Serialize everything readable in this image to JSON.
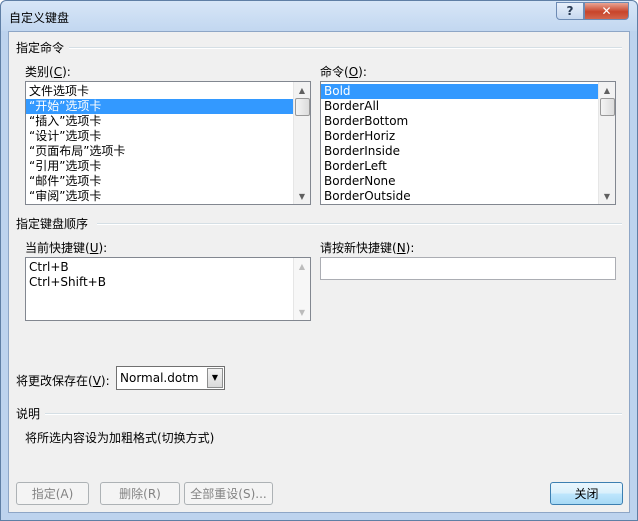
{
  "window": {
    "title": "自定义键盘"
  },
  "caption": {
    "help": "?",
    "close": "✕"
  },
  "specify_commands": {
    "group_label": "指定命令",
    "categories_label": "类别(",
    "categories_key": "C",
    "categories_suffix": "):",
    "categories": [
      "文件选项卡",
      "“开始”选项卡",
      "“插入”选项卡",
      "“设计”选项卡",
      "“页面布局”选项卡",
      "“引用”选项卡",
      "“邮件”选项卡",
      "“审阅”选项卡"
    ],
    "commands_label": "命令(",
    "commands_key": "O",
    "commands_suffix": "):",
    "commands": [
      "Bold",
      "BorderAll",
      "BorderBottom",
      "BorderHoriz",
      "BorderInside",
      "BorderLeft",
      "BorderNone",
      "BorderOutside"
    ]
  },
  "keyboard_sequence": {
    "group_label": "指定键盘顺序",
    "current_keys_label": "当前快捷键(",
    "current_keys_key": "U",
    "current_keys_suffix": "):",
    "current_keys": [
      "Ctrl+B",
      "Ctrl+Shift+B"
    ],
    "new_key_label": "请按新快捷键(",
    "new_key_key": "N",
    "new_key_suffix": "):",
    "new_key_value": ""
  },
  "save_in": {
    "label": "将更改保存在(",
    "key": "V",
    "suffix": "):",
    "value": "Normal.dotm"
  },
  "description": {
    "group_label": "说明",
    "text": "将所选内容设为加粗格式(切换方式)"
  },
  "buttons": {
    "assign": "指定(A)",
    "remove": "删除(R)",
    "reset_all": "全部重设(S)...",
    "close": "关闭"
  },
  "colors": {
    "selection": "#3399ff",
    "title_bar": "#c2d7f0",
    "close_caption": "#c8442a"
  }
}
